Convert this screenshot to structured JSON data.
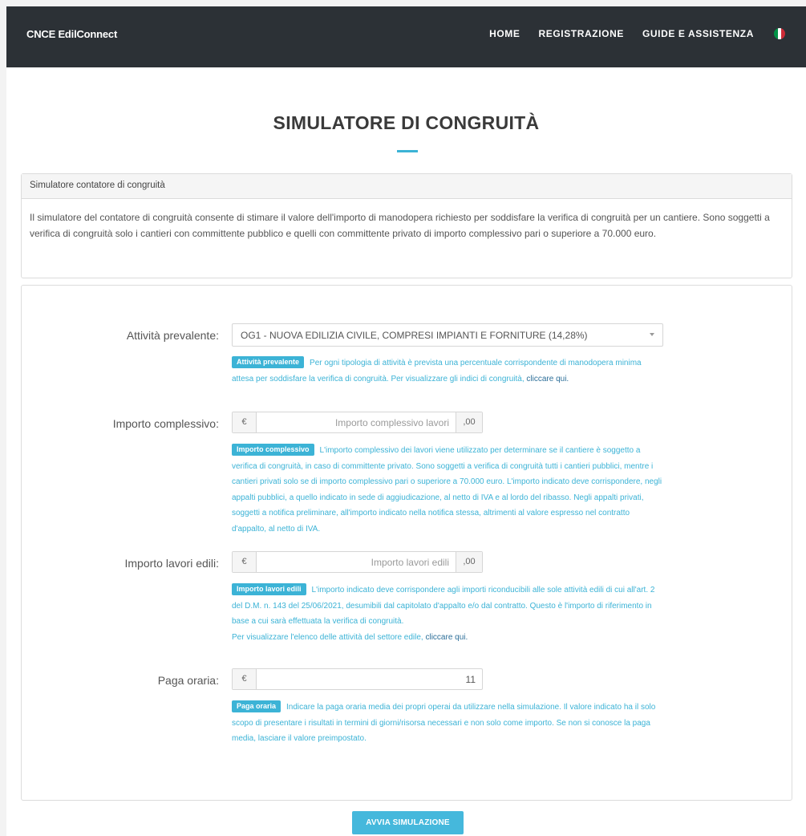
{
  "navbar": {
    "brand": "CNCE EdilConnect",
    "links": [
      "HOME",
      "REGISTRAZIONE",
      "GUIDE E ASSISTENZA"
    ],
    "language_flag": "italy-flag-icon",
    "flag_colors": [
      "#009246",
      "#ffffff",
      "#ce2b37"
    ]
  },
  "page": {
    "title": "SIMULATORE DI CONGRUITÀ",
    "accent_color": "#3cb3d6"
  },
  "info_panel": {
    "heading": "Simulatore contatore di congruità",
    "body": "Il simulatore del contatore di congruità consente di stimare il valore dell'importo di manodopera richiesto per soddisfare la verifica di congruità per un cantiere. Sono soggetti a verifica di congruità solo i cantieri con committente pubblico e quelli con committente privato di importo complessivo pari o superiore a 70.000 euro."
  },
  "form": {
    "attivita": {
      "label": "Attività prevalente:",
      "selected": "OG1 - NUOVA EDILIZIA CIVILE, COMPRESI IMPIANTI E FORNITURE (14,28%)",
      "badge": "Attività prevalente",
      "help": "Per ogni tipologia di attività è prevista una percentuale corrispondente di manodopera minima attesa per soddisfare la verifica di congruità. Per visualizzare gli indici di congruità, ",
      "help_link": "cliccare qui."
    },
    "importo_complessivo": {
      "label": "Importo complessivo:",
      "prefix": "€",
      "placeholder": "Importo complessivo lavori",
      "suffix": ",00",
      "value": "",
      "badge": "Importo complessivo",
      "help": "L'importo complessivo dei lavori viene utilizzato per determinare se il cantiere è soggetto a verifica di congruità, in caso di committente privato. Sono soggetti a verifica di congruità tutti i cantieri pubblici, mentre i cantieri privati solo se di importo complessivo pari o superiore a 70.000 euro. L'importo indicato deve corrispondere, negli appalti pubblici, a quello indicato in sede di aggiudicazione, al netto di IVA e al lordo del ribasso. Negli appalti privati, soggetti a notifica preliminare, all'importo indicato nella notifica stessa, altrimenti al valore espresso nel contratto d'appalto, al netto di IVA."
    },
    "importo_lavori_edili": {
      "label": "Importo lavori edili:",
      "prefix": "€",
      "placeholder": "Importo lavori edili",
      "suffix": ",00",
      "value": "",
      "badge": "Importo lavori edili",
      "help": "L'importo indicato deve corrispondere agli importi riconducibili alle sole attività edili di cui all'art. 2 del D.M. n. 143 del 25/06/2021, desumibili dal capitolato d'appalto e/o dal contratto. Questo è l'importo di riferimento in base a cui sarà effettuata la verifica di congruità.",
      "help2": "Per visualizzare l'elenco delle attività del settore edile, ",
      "help_link": "cliccare qui."
    },
    "paga_oraria": {
      "label": "Paga oraria:",
      "prefix": "€",
      "value": "11",
      "badge": "Paga oraria",
      "help": "Indicare la paga oraria media dei propri operai da utilizzare nella simulazione. Il valore indicato ha il solo scopo di presentare i risultati in termini di giorni/risorsa necessari e non solo come importo. Se non si conosce la paga media, lasciare il valore preimpostato."
    },
    "submit_label": "AVVIA SIMULAZIONE"
  }
}
